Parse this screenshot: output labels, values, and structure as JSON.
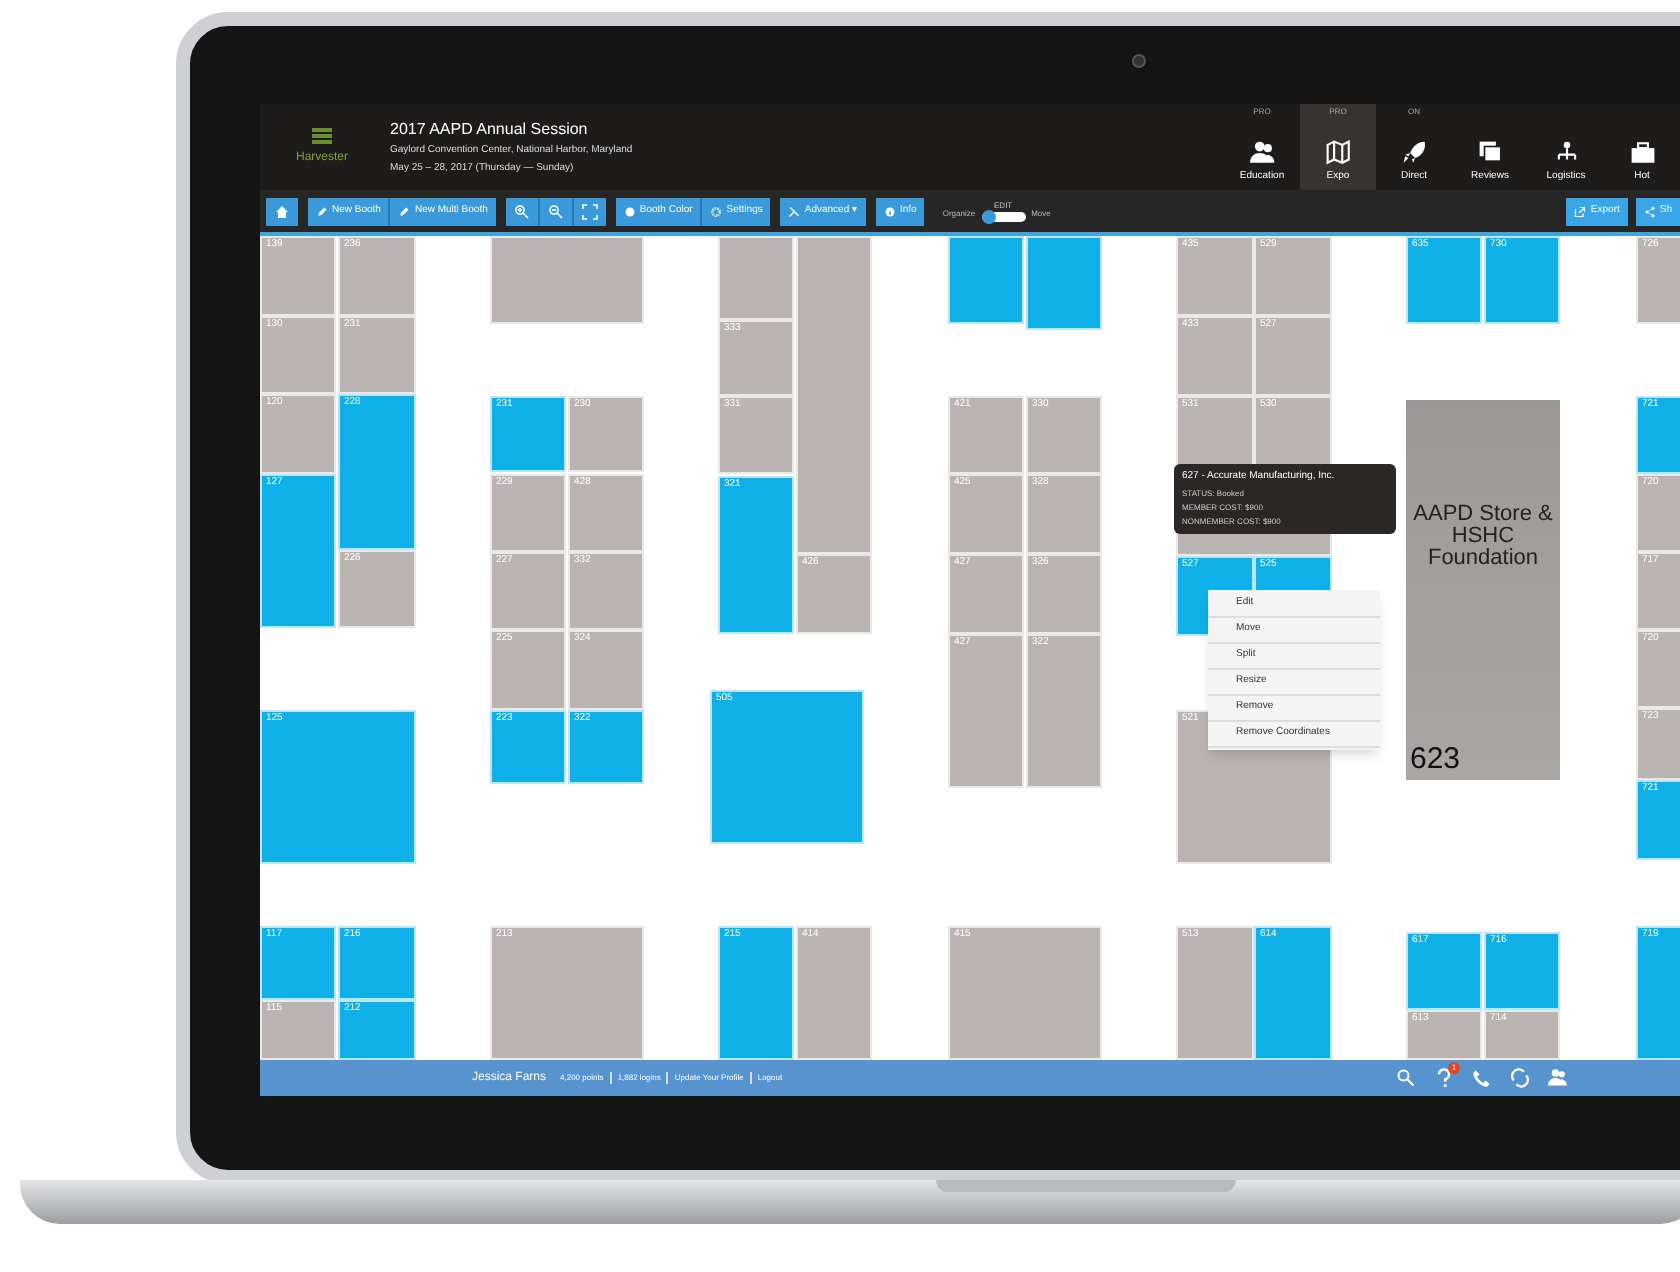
{
  "header": {
    "app_name": "Harvester",
    "title": "2017 AAPD Annual Session",
    "location": "Gaylord Convention Center, National Harbor, Maryland",
    "dates": "May 25 – 28, 2017 (Thursday — Sunday)"
  },
  "nav": [
    {
      "label": "Education",
      "badge": "PRO",
      "selected": false
    },
    {
      "label": "Expo",
      "badge": "PRO",
      "selected": true
    },
    {
      "label": "Direct",
      "badge": "ON",
      "selected": false
    },
    {
      "label": "Reviews",
      "selected": false
    },
    {
      "label": "Logistics",
      "selected": false
    },
    {
      "label": "Hot",
      "selected": false
    }
  ],
  "toolbar": [
    "New Booth",
    "New Multi Booth",
    "Booth Color",
    "Settings",
    "Advanced ▾",
    "Info"
  ],
  "mode_toggle": {
    "caption": "EDIT",
    "left_label": "Organize",
    "right_label": "Move",
    "on": false
  },
  "toolbar_right": [
    "Export",
    "Sh"
  ],
  "booths": [
    {
      "number": "139",
      "booked": false
    },
    {
      "number": "236",
      "booked": false
    },
    {
      "number": "130",
      "booked": false
    },
    {
      "number": "231",
      "booked": false
    },
    {
      "number": "120",
      "booked": false
    },
    {
      "number": "228",
      "booked": true
    },
    {
      "number": "127",
      "booked": true
    },
    {
      "number": "226",
      "booked": false
    },
    {
      "number": "125",
      "booked": true
    },
    {
      "number": "117",
      "booked": true
    },
    {
      "number": "216",
      "booked": true
    },
    {
      "number": "115",
      "booked": false
    },
    {
      "number": "212",
      "booked": true
    },
    {
      "booked": false
    },
    {
      "number": "231",
      "booked": true
    },
    {
      "number": "230",
      "booked": false
    },
    {
      "number": "229",
      "booked": false
    },
    {
      "number": "428",
      "booked": false
    },
    {
      "number": "227",
      "booked": false
    },
    {
      "number": "332",
      "booked": false
    },
    {
      "number": "225",
      "booked": false
    },
    {
      "number": "324",
      "booked": false
    },
    {
      "number": "223",
      "booked": true
    },
    {
      "number": "322",
      "booked": true
    },
    {
      "number": "213",
      "booked": false
    },
    {
      "booked": false
    },
    {
      "booked": false
    },
    {
      "number": "333",
      "booked": false
    },
    {
      "number": "331",
      "booked": false
    },
    {
      "number": "321",
      "booked": true
    },
    {
      "number": "426",
      "booked": false
    },
    {
      "number": "505",
      "booked": true
    },
    {
      "number": "215",
      "booked": true
    },
    {
      "number": "414",
      "booked": false
    },
    {
      "booked": true
    },
    {
      "booked": true
    },
    {
      "number": "421",
      "booked": false
    },
    {
      "number": "330",
      "booked": false
    },
    {
      "number": "425",
      "booked": false
    },
    {
      "number": "328",
      "booked": false
    },
    {
      "number": "427",
      "booked": false
    },
    {
      "number": "326",
      "booked": false
    },
    {
      "number": "427",
      "booked": false
    },
    {
      "number": "322",
      "booked": false
    },
    {
      "number": "415",
      "booked": false
    },
    {
      "number": "435",
      "booked": false
    },
    {
      "number": "529",
      "booked": false
    },
    {
      "number": "433",
      "booked": false
    },
    {
      "number": "527",
      "booked": false
    },
    {
      "number": "531",
      "booked": false
    },
    {
      "number": "530",
      "booked": false
    },
    {
      "booked": false
    },
    {
      "number": "527",
      "booked": true
    },
    {
      "number": "525",
      "booked": true
    },
    {
      "number": "521",
      "booked": false
    },
    {
      "number": "513",
      "booked": false
    },
    {
      "number": "614",
      "booked": true
    },
    {
      "number": "635",
      "booked": true
    },
    {
      "number": "730",
      "booked": true
    },
    {
      "number": "617",
      "booked": true
    },
    {
      "number": "716",
      "booked": true
    },
    {
      "number": "613",
      "booked": false
    },
    {
      "number": "714",
      "booked": false
    },
    {
      "number": "726",
      "booked": false
    },
    {
      "number": "721",
      "booked": true
    },
    {
      "number": "720",
      "booked": false
    },
    {
      "number": "717",
      "booked": false
    },
    {
      "number": "720",
      "booked": false
    },
    {
      "number": "723",
      "booked": false
    },
    {
      "number": "721",
      "booked": true
    },
    {
      "number": "719",
      "booked": true
    }
  ],
  "store": {
    "label": "AAPD Store & HSHC Foundation",
    "number": "623"
  },
  "tooltip": {
    "title": "627 - Accurate Manufacturing, Inc.",
    "lines": [
      "STATUS: Booked",
      "MEMBER COST: $900",
      "NONMEMBER COST: $900"
    ]
  },
  "context_menu": [
    "Edit",
    "Move",
    "Split",
    "Resize",
    "Remove",
    "Remove Coordinates"
  ],
  "footer": {
    "user": "Jessica Farns",
    "stats": [
      "4,200 points",
      "1,882 logins",
      "Update Your Profile",
      "Logout"
    ],
    "help_badge": "1"
  }
}
